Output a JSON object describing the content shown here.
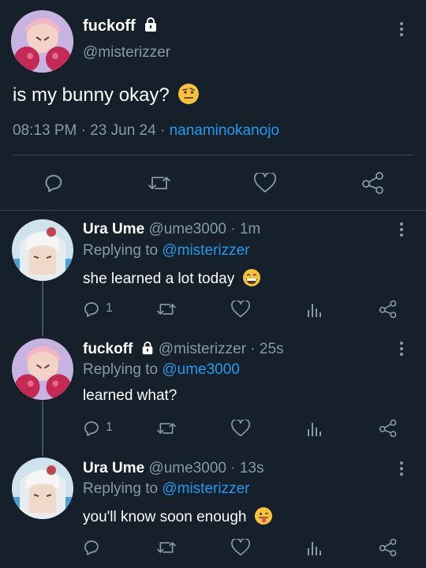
{
  "main_tweet": {
    "display_name": "fuckoff",
    "handle": "@misterizzer",
    "text": "is my bunny okay?",
    "emoji": "raised-eyebrow-emoji",
    "time": "08:13 PM",
    "date": "23 Jun 24",
    "source": "nanaminokanojo",
    "actions": [
      "reply-icon",
      "retweet-icon",
      "like-icon",
      "share-icon"
    ]
  },
  "replies": [
    {
      "display_name": "Ura Ume",
      "handle": "@ume3000",
      "age": "1m",
      "replying_label": "Replying to",
      "replying_to": "@misterizzer",
      "text": "she learned a lot today",
      "emoji": "grinning-emoji",
      "reply_count": "1"
    },
    {
      "display_name": "fuckoff",
      "handle": "@misterizzer",
      "age": "25s",
      "replying_label": "Replying to",
      "replying_to": "@ume3000",
      "text": "learned what?",
      "reply_count": "1"
    },
    {
      "display_name": "Ura Ume",
      "handle": "@ume3000",
      "age": "13s",
      "replying_label": "Replying to",
      "replying_to": "@misterizzer",
      "text": "you'll know soon enough",
      "emoji": "tongue-out-emoji",
      "reply_count": ""
    }
  ],
  "separator": "·",
  "colors": {
    "background": "#15202b",
    "muted": "#8899a6",
    "link": "#1d9bf0",
    "divider": "#38444d"
  }
}
